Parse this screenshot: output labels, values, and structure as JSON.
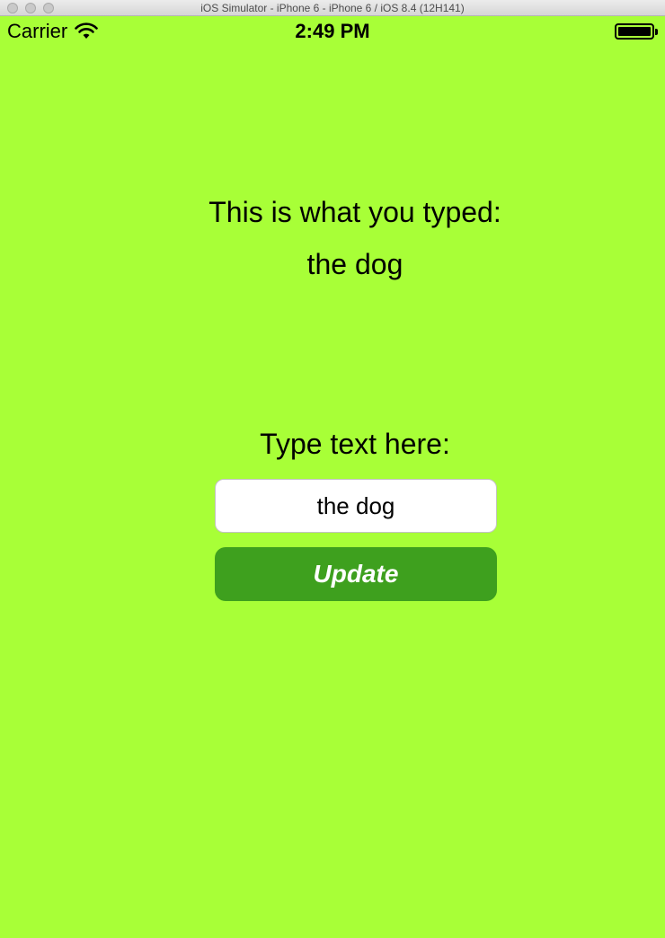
{
  "window": {
    "title": "iOS Simulator - iPhone 6 - iPhone 6 / iOS 8.4 (12H141)"
  },
  "status_bar": {
    "carrier": "Carrier",
    "time": "2:49 PM",
    "icons": [
      "wifi-icon",
      "battery-icon"
    ]
  },
  "output": {
    "caption": "This is what you typed:",
    "value": "the dog"
  },
  "input": {
    "caption": "Type text here:",
    "value": "the dog"
  },
  "update_button": {
    "label": "Update"
  },
  "colors": {
    "background": "#a8ff37",
    "button": "#3ea01e",
    "button_text": "#ffffff",
    "text": "#000000"
  }
}
